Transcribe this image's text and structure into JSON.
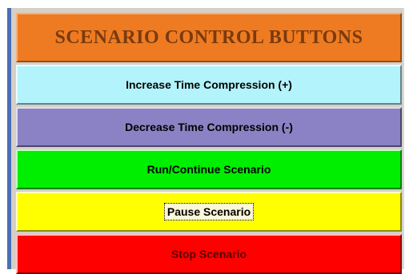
{
  "panel": {
    "title": "SCENARIO CONTROL BUTTONS"
  },
  "buttons": {
    "increase": "Increase Time Compression (+)",
    "decrease": "Decrease Time Compression (-)",
    "run": "Run/Continue Scenario",
    "pause": "Pause Scenario",
    "stop": "Stop Scenario"
  },
  "colors": {
    "header": "#ee7b22",
    "header_text": "#7a3a0e",
    "increase": "#b3f3fb",
    "decrease": "#8a82c4",
    "run": "#00ee00",
    "pause": "#ffff00",
    "stop": "#ff0000"
  },
  "state": {
    "focused_button": "pause"
  }
}
